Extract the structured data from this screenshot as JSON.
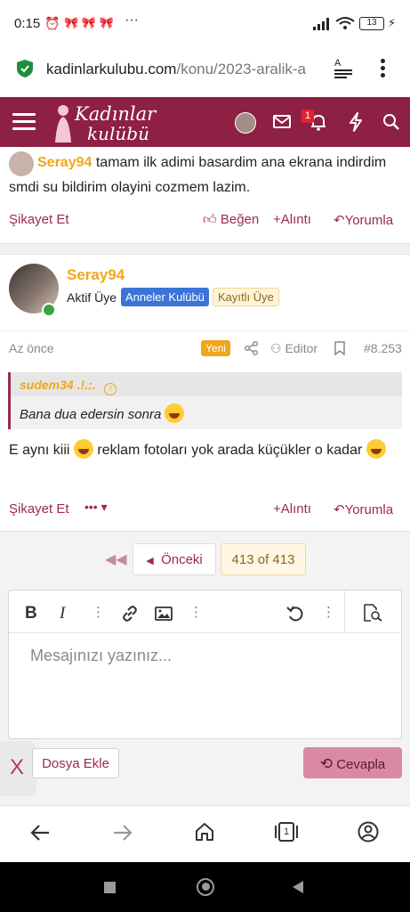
{
  "status_bar": {
    "time": "0:15",
    "battery": "13"
  },
  "browser": {
    "url_domain": "kadinlarkulubu.com",
    "url_path": "/konu/2023-aralik-a"
  },
  "site": {
    "logo_line1": "Kadınlar",
    "logo_line2": "kulübü",
    "notification_count": "1"
  },
  "prev_post": {
    "author": "Seray94",
    "text": "tamam ilk adimi basardim ana ekrana indirdim smdi su bildirim olayini cozmem lazim.",
    "report": "Şikayet Et",
    "like": "Beğen",
    "quote": "Alıntı",
    "comment": "Yorumla"
  },
  "post": {
    "author": "Seray94",
    "role": "Aktif Üye",
    "badge_club": "Anneler Kulübü",
    "badge_registered": "Kayıtlı Üye",
    "time": "Az önce",
    "new_label": "Yeni",
    "editor_label": "Editor",
    "post_number": "#8.253",
    "quote_author": "sudem34 .!.:.",
    "quote_text": "Bana dua edersin sonra",
    "text_line1": "E aynı kiii",
    "text_line1b": "reklam fotoları yok arada küçükler o kadar",
    "report": "Şikayet Et",
    "more": "•••",
    "quote": "Alıntı",
    "comment": "Yorumla"
  },
  "pagination": {
    "prev_label": "Önceki",
    "current": "413 of 413"
  },
  "editor": {
    "placeholder": "Mesajınızı yazınız...",
    "attach_label": "Dosya Ekle",
    "reply_label": "Cevapla",
    "close_label": "X"
  },
  "colors": {
    "brand": "#8e2044",
    "accent": "#9b2950",
    "author": "#f2a61a"
  }
}
